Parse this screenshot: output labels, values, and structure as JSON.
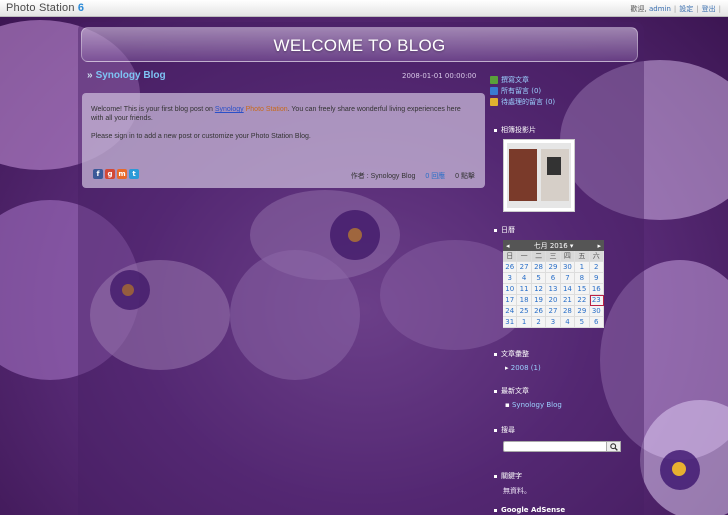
{
  "app": {
    "logo_text": "Photo Station",
    "logo_version": "6"
  },
  "userbar": {
    "greeting": "歡迎, ",
    "username": "admin",
    "settings": "設定",
    "logout": "登出",
    "trailing_sep": "|"
  },
  "blog": {
    "title": "WELCOME TO BLOG"
  },
  "post": {
    "title": "Synology Blog",
    "date": "2008-01-01 00:00:00",
    "body_1_pre": "Welcome! This is your first blog post on ",
    "body_1_link1": "Synology",
    "body_1_link2": "Photo Station",
    "body_1_post": ". You can freely share wonderful living experiences here with all your friends.",
    "body_2": "Please sign in to add a new post or customize your Photo Station Blog.",
    "author_label": "作者 : ",
    "author": "Synology Blog",
    "reply_count": "0",
    "reply_label": "回應",
    "click_count": "0",
    "click_label": "點擊"
  },
  "share_icons": [
    "facebook-icon",
    "google-plus-icon",
    "myspace-icon",
    "twitter-icon"
  ],
  "sidebar": {
    "links": [
      {
        "label": "撰寫文章",
        "icon": "write-icon",
        "color": "#5aa03a"
      },
      {
        "label": "所有留言 (0)",
        "icon": "comments-icon",
        "color": "#3a7ad0"
      },
      {
        "label": "待處理的留言 (0)",
        "icon": "folder-icon",
        "color": "#e0b030"
      }
    ],
    "slideshow_title": "相簿投影片",
    "calendar_title": "日曆",
    "archives_title": "文章彙整",
    "archives_item": "2008 (1)",
    "recent_title": "最新文章",
    "recent_item": "Synology Blog",
    "search_title": "搜尋",
    "keywords_title": "關鍵字",
    "keywords_empty": "無資料。",
    "adsense_title": "Google AdSense"
  },
  "calendar": {
    "prev": "◂",
    "next": "▸",
    "month_label": "七月 2016 ▾",
    "dow": [
      "日",
      "一",
      "二",
      "三",
      "四",
      "五",
      "六"
    ],
    "days": [
      "26",
      "27",
      "28",
      "29",
      "30",
      "1",
      "2",
      "3",
      "4",
      "5",
      "6",
      "7",
      "8",
      "9",
      "10",
      "11",
      "12",
      "13",
      "14",
      "15",
      "16",
      "17",
      "18",
      "19",
      "20",
      "21",
      "22",
      "23",
      "24",
      "25",
      "26",
      "27",
      "28",
      "29",
      "30",
      "31",
      "1",
      "2",
      "3",
      "4",
      "5",
      "6"
    ],
    "today": "23"
  }
}
